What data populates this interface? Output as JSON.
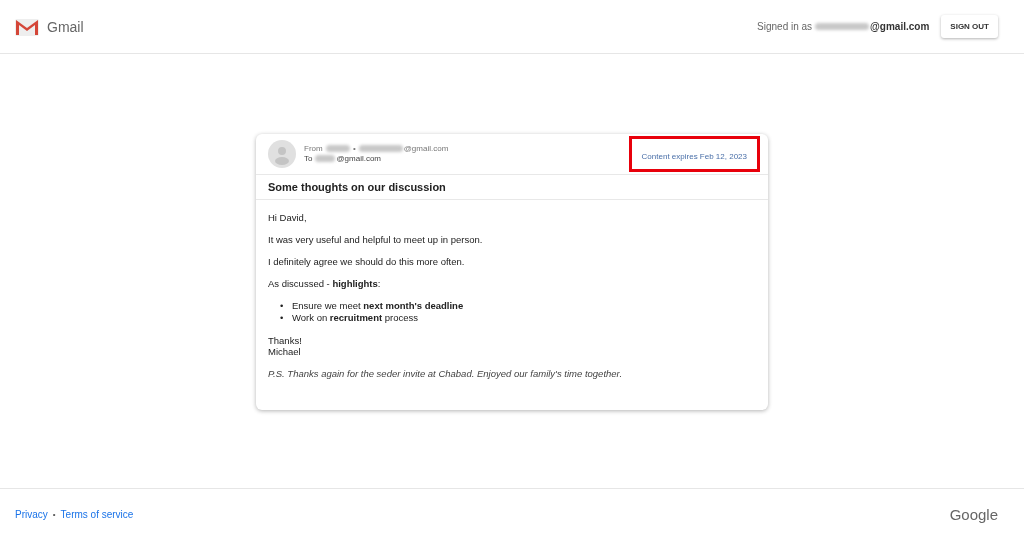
{
  "header": {
    "app_name": "Gmail",
    "signed_in_label": "Signed in as",
    "signed_in_domain": "@gmail.com",
    "sign_out": "SIGN OUT"
  },
  "message": {
    "from_label": "From",
    "from_separator": "•",
    "from_domain": "@gmail.com",
    "to_label": "To",
    "to_domain": "@gmail.com",
    "expiry": "Content expires Feb 12, 2023",
    "expiry_highlighted": true,
    "subject": "Some thoughts on our discussion",
    "body": [
      {
        "kind": "paragraph",
        "text": "Hi David,"
      },
      {
        "kind": "paragraph",
        "text": "It was very useful and helpful to meet up in person."
      },
      {
        "kind": "paragraph",
        "text": "I definitely agree we should do this more often."
      },
      {
        "kind": "paragraph",
        "text": "As discussed - **highlights**:"
      },
      {
        "kind": "bullets",
        "marker": "•",
        "items": [
          "Ensure we meet **next month's deadline**",
          "Work on **recruitment** process"
        ]
      },
      {
        "kind": "lines",
        "lines": [
          "Thanks!",
          "Michael"
        ]
      },
      {
        "kind": "italic",
        "text": "P.S. Thanks again for the seder invite at Chabad. Enjoyed our family's time together."
      }
    ]
  },
  "footer": {
    "links": [
      "Privacy",
      "Terms of service"
    ],
    "separator": "•",
    "brand": "Google"
  }
}
